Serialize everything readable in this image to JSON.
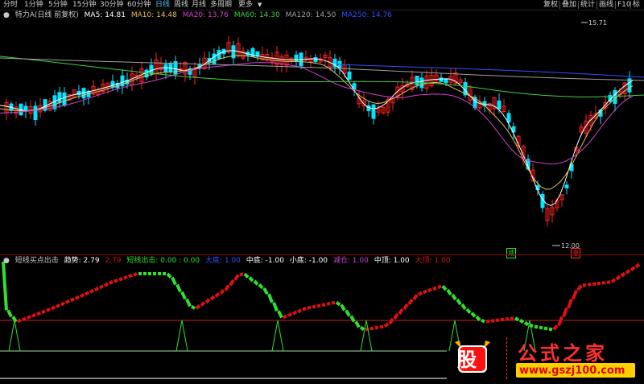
{
  "toolbar": {
    "periods": [
      "分时",
      "1分钟",
      "5分钟",
      "15分钟",
      "30分钟",
      "60分钟",
      "日线",
      "周线",
      "月线",
      "多周期",
      "更多"
    ],
    "active": "日线",
    "right": [
      "复权",
      "叠加",
      "统计",
      "画线",
      "F10",
      "标记"
    ]
  },
  "main_legend": {
    "name": "特力A(日线 前复权)",
    "ma5": "MA5: 14.81",
    "ma10": "MA10: 14.48",
    "ma20": "MA20: 13.76",
    "ma60": "MA60: 14.30",
    "ma120": "MA120: 14.50",
    "ma250": "MA250: 14.76"
  },
  "sub_legend": {
    "name": "短线买点出击",
    "trend_label": "趋势: 2.79",
    "trend_val": "2.79",
    "strike": "短线出击: 0.00 : 0.00",
    "big_bottom": "大底: 1.00",
    "mid_bottom": "中底: -1.00",
    "small_bottom": "小底: -1.00",
    "reduce": "减仓: 1.00",
    "mid_top": "中顶: 1.00",
    "big_top": "大顶: 1.00"
  },
  "price_tags": {
    "high": "15.71",
    "low": "12.00"
  },
  "signals": {
    "sell": "减",
    "buy": "涨"
  },
  "logo": {
    "badge": "股",
    "name": "公式之家",
    "url": "www.gszj100.com"
  },
  "colors": {
    "up": "#ff2020",
    "down": "#00e5ff",
    "ma5": "#ffffff",
    "ma10": "#e0c060",
    "ma20": "#d040d0",
    "ma60": "#40d040",
    "ma120": "#a0a0a0",
    "ma250": "#3050ff",
    "sub_up": "#e01010",
    "sub_down": "#30e030"
  }
}
